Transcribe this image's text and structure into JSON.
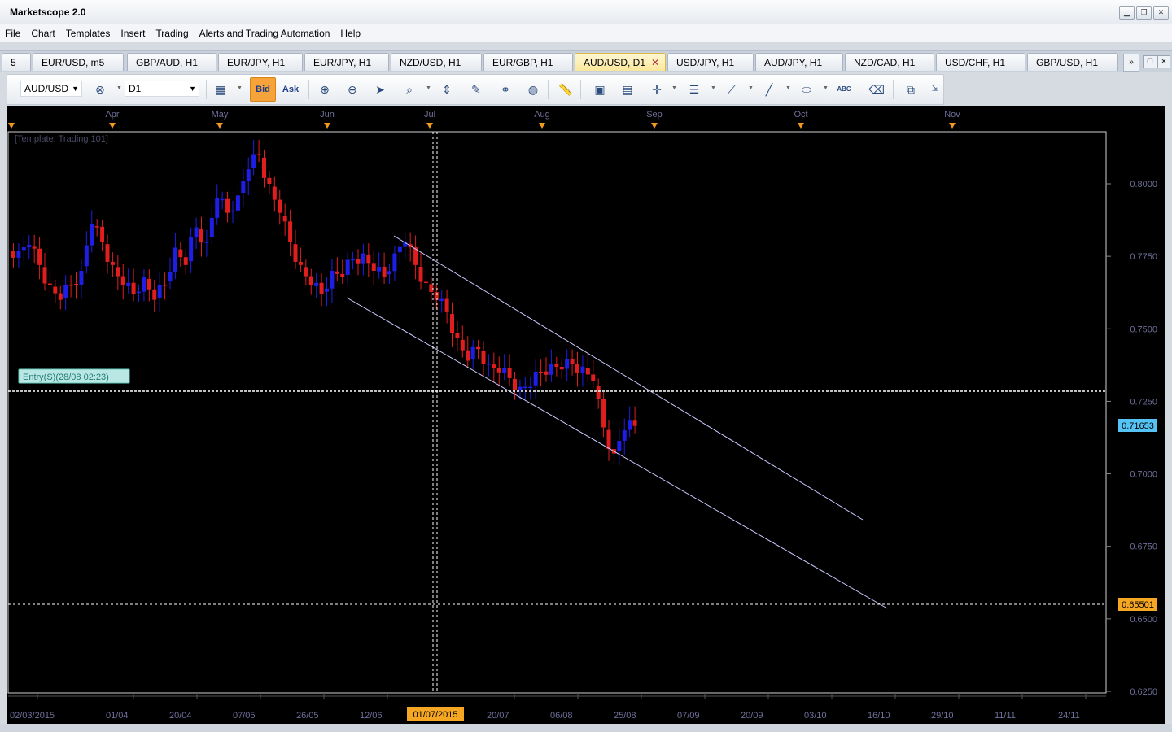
{
  "window": {
    "title": "Marketscope 2.0",
    "buttons": [
      "▁",
      "❐",
      "✕"
    ]
  },
  "menu": [
    "File",
    "Chart",
    "Templates",
    "Insert",
    "Trading",
    "Alerts and Trading Automation",
    "Help"
  ],
  "tabs": [
    {
      "label": "5",
      "active": false
    },
    {
      "label": "EUR/USD, m5",
      "active": false
    },
    {
      "label": "GBP/AUD, H1",
      "active": false
    },
    {
      "label": "EUR/JPY, H1",
      "active": false
    },
    {
      "label": "EUR/JPY, H1",
      "active": false
    },
    {
      "label": "NZD/USD, H1",
      "active": false
    },
    {
      "label": "EUR/GBP, H1",
      "active": false
    },
    {
      "label": "AUD/USD, D1",
      "active": true
    },
    {
      "label": "USD/JPY, H1",
      "active": false
    },
    {
      "label": "AUD/JPY, H1",
      "active": false
    },
    {
      "label": "NZD/CAD, H1",
      "active": false
    },
    {
      "label": "USD/CHF, H1",
      "active": false
    },
    {
      "label": "GBP/USD, H1",
      "active": false
    }
  ],
  "tab_close_icon": "✕",
  "tab_scroll_icon": "»",
  "toolbar": {
    "symbol": "AUD/USD",
    "timeframe": "D1",
    "bid_label": "Bid",
    "ask_label": "Ask",
    "text_tool_label": "ABC"
  },
  "chart": {
    "template_label": "[Template: Trading 101]",
    "entry_label": "Entry(S)(28/08 02:23)",
    "current_price": "0.71653",
    "target_price": "0.65501",
    "crosshair_date": "01/07/2015",
    "months": [
      "Apr",
      "May",
      "Jun",
      "Jul",
      "Aug",
      "Sep",
      "Oct",
      "Nov"
    ],
    "price_ticks": [
      "0.8000",
      "0.7750",
      "0.7500",
      "0.7250",
      "0.7000",
      "0.6750",
      "0.6500",
      "0.6250"
    ],
    "date_ticks": [
      "02/03/2015",
      "01/04",
      "20/04",
      "07/05",
      "26/05",
      "12/06",
      "20/07",
      "06/08",
      "25/08",
      "07/09",
      "20/09",
      "03/10",
      "16/10",
      "29/10",
      "11/11",
      "24/11"
    ],
    "colors": {
      "background": "#000000",
      "bull": "#1e1ee6",
      "bear": "#e01e1e",
      "channel": "#c8c8ff",
      "axis_text": "#6f6f9a",
      "marker": "#f29a1e",
      "price_box": "#55c4f5",
      "target_box": "#f5a623"
    }
  },
  "chart_data": {
    "type": "candlestick",
    "title": "AUD/USD, D1",
    "y_range": [
      0.62,
      0.82
    ],
    "close_series_approx": [
      0.777,
      0.779,
      0.772,
      0.765,
      0.76,
      0.765,
      0.77,
      0.786,
      0.78,
      0.772,
      0.765,
      0.762,
      0.768,
      0.76,
      0.765,
      0.778,
      0.772,
      0.785,
      0.78,
      0.795,
      0.79,
      0.796,
      0.805,
      0.81,
      0.8,
      0.79,
      0.78,
      0.772,
      0.765,
      0.762,
      0.77,
      0.768,
      0.774,
      0.776,
      0.77,
      0.768,
      0.776,
      0.78,
      0.772,
      0.766,
      0.76,
      0.756,
      0.747,
      0.739,
      0.743,
      0.738,
      0.735,
      0.733,
      0.73,
      0.73,
      0.735,
      0.738,
      0.736,
      0.738,
      0.737,
      0.732,
      0.716,
      0.707,
      0.715,
      0.7165
    ]
  }
}
